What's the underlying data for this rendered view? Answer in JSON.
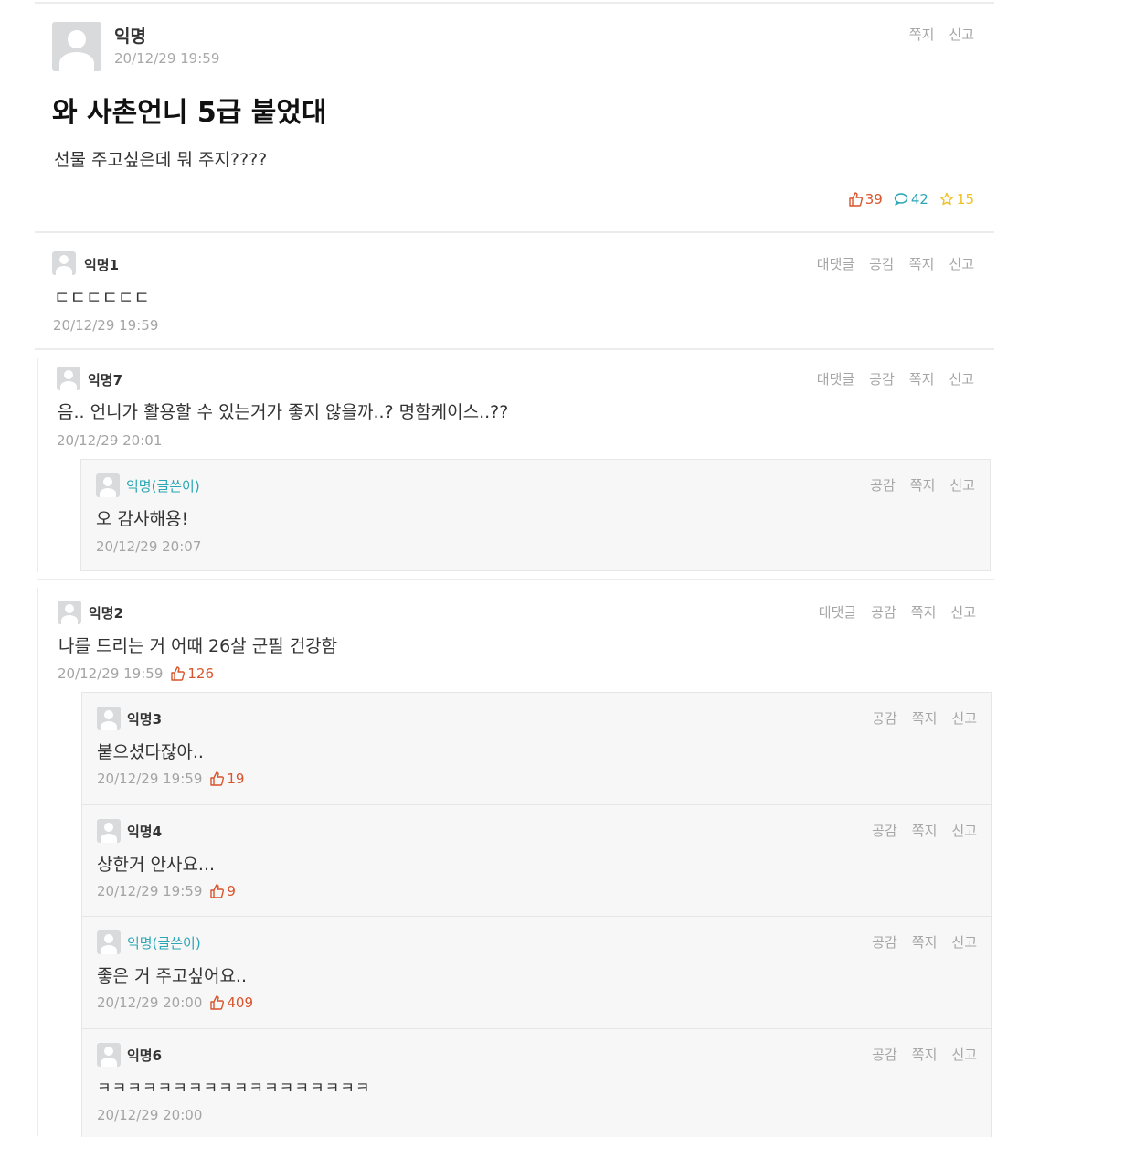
{
  "post": {
    "author": "익명",
    "date": "20/12/29 19:59",
    "title": "와 사촌언니 5급 붙었대",
    "body": "선물 주고싶은데 뭐 주지????",
    "actions": [
      "쪽지",
      "신고"
    ],
    "stats": {
      "likes": "39",
      "comments": "42",
      "scraps": "15"
    }
  },
  "labels": {
    "reply": "대댓글",
    "like": "공감",
    "message": "쪽지",
    "report": "신고"
  },
  "comments": [
    {
      "author": "익명1",
      "text": "ㄷㄷㄷㄷㄷㄷ",
      "date": "20/12/29 19:59",
      "likes": ""
    },
    {
      "author": "익명7",
      "text": "음.. 언니가 활용할 수 있는거가 좋지 않을까..? 명함케이스..??",
      "date": "20/12/29 20:01",
      "likes": "",
      "replies": [
        {
          "author": "익명(글쓴이)",
          "text": "오 감사해용!",
          "date": "20/12/29 20:07",
          "likes": ""
        }
      ]
    },
    {
      "author": "익명2",
      "text": "나를 드리는 거 어때 26살 군필 건강함",
      "date": "20/12/29 19:59",
      "likes": "126",
      "replies": [
        {
          "author": "익명3",
          "text": "붙으셨다잖아..",
          "date": "20/12/29 19:59",
          "likes": "19"
        },
        {
          "author": "익명4",
          "text": "상한거 안사요...",
          "date": "20/12/29 19:59",
          "likes": "9"
        },
        {
          "author": "익명(글쓴이)",
          "text": "좋은 거 주고싶어요..",
          "date": "20/12/29 20:00",
          "likes": "409"
        },
        {
          "author": "익명6",
          "text": "ㅋㅋㅋㅋㅋㅋㅋㅋㅋㅋㅋㅋㅋㅋㅋㅋㅋㅋ",
          "date": "20/12/29 20:00",
          "likes": ""
        }
      ]
    }
  ],
  "colors": {
    "like": "#d8542c",
    "comment": "#2aa6b4",
    "scrap": "#f0c020",
    "op": "#2aa6b4"
  }
}
